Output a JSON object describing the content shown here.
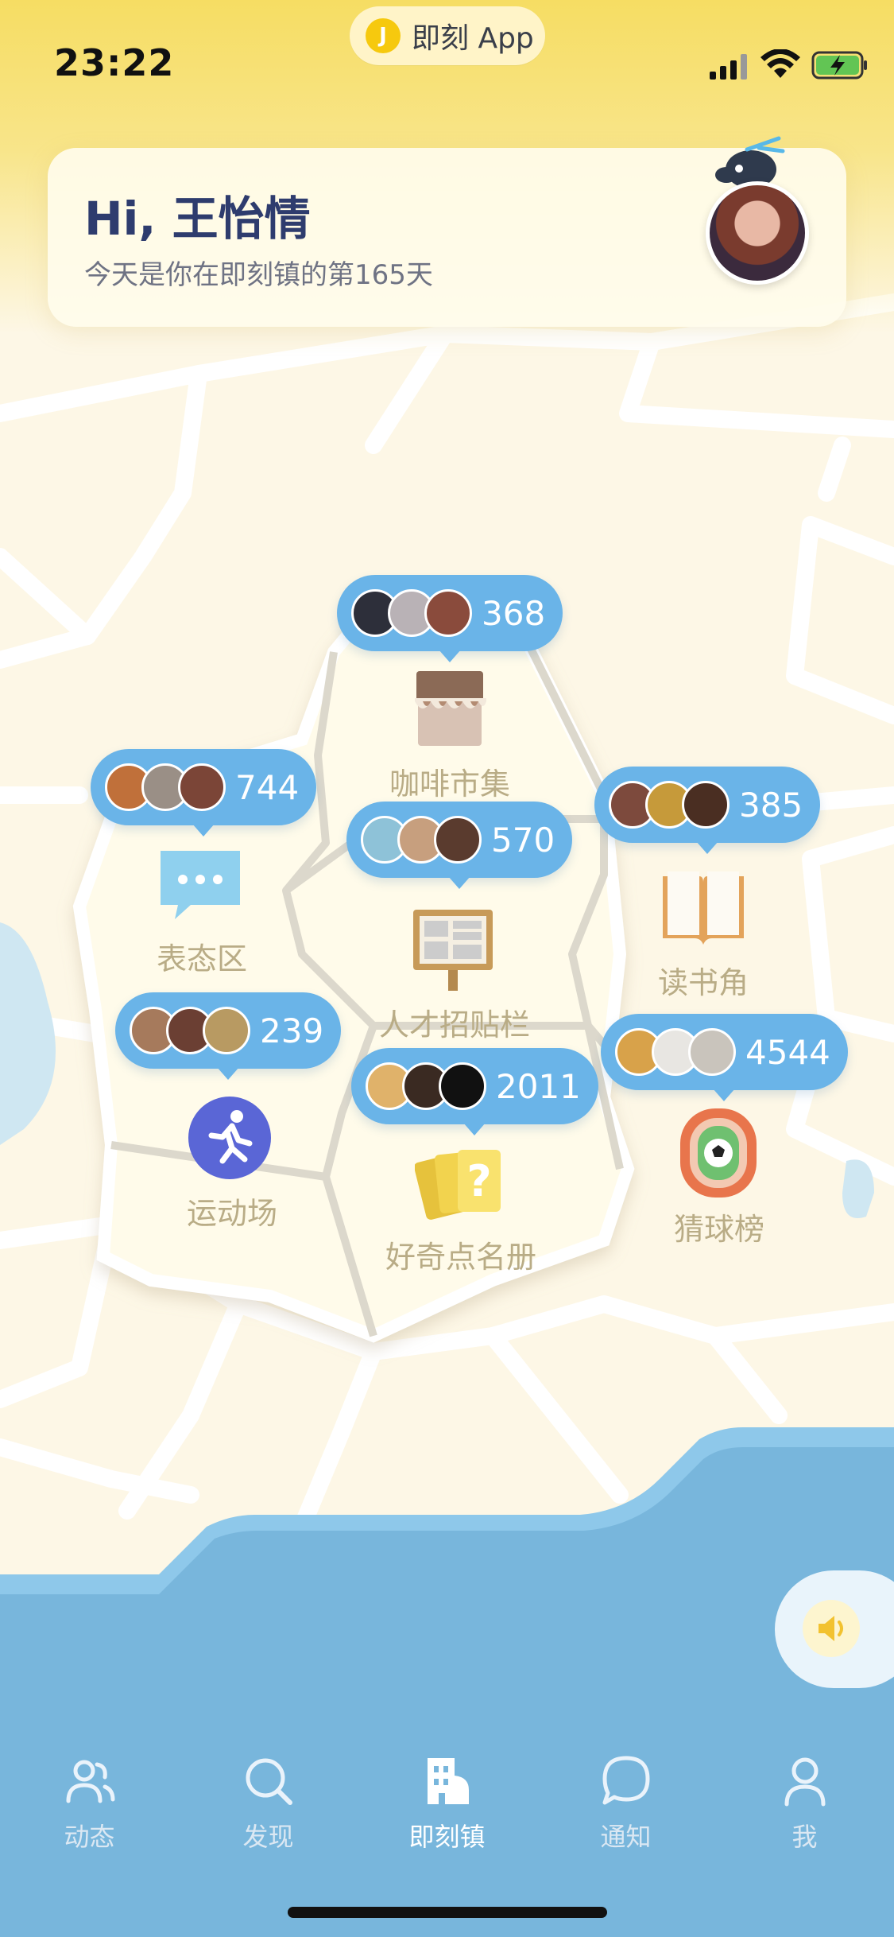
{
  "status_bar": {
    "time": "23:22",
    "app_pill_label": "即刻 App"
  },
  "greeting": {
    "title": "Hi, 王怡情",
    "subtitle": "今天是你在即刻镇的第165天"
  },
  "places": [
    {
      "id": "cafe",
      "name": "咖啡市集",
      "count": "368",
      "icon": "cafe-stall-icon"
    },
    {
      "id": "express",
      "name": "表态区",
      "count": "744",
      "icon": "chat-bubble-icon"
    },
    {
      "id": "jobs",
      "name": "人才招贴栏",
      "count": "570",
      "icon": "bulletin-board-icon"
    },
    {
      "id": "reading",
      "name": "读书角",
      "count": "385",
      "icon": "open-book-icon"
    },
    {
      "id": "sports",
      "name": "运动场",
      "count": "239",
      "icon": "running-person-icon"
    },
    {
      "id": "curious",
      "name": "好奇点名册",
      "count": "2011",
      "icon": "question-cards-icon"
    },
    {
      "id": "football",
      "name": "猜球榜",
      "count": "4544",
      "icon": "soccer-field-icon"
    }
  ],
  "tabbar": {
    "tabs": [
      {
        "label": "动态",
        "icon": "people-icon",
        "active": false
      },
      {
        "label": "发现",
        "icon": "search-icon",
        "active": false
      },
      {
        "label": "即刻镇",
        "icon": "buildings-icon",
        "active": true
      },
      {
        "label": "通知",
        "icon": "chat-bubble-icon",
        "active": false
      },
      {
        "label": "我",
        "icon": "person-icon",
        "active": false
      }
    ]
  },
  "colors": {
    "header_yellow": "#f6dd63",
    "bubble_blue": "#6ab4e8",
    "sea_blue": "#78b6dc",
    "title_navy": "#2e3c6e",
    "label_khaki": "#b9ac86"
  }
}
